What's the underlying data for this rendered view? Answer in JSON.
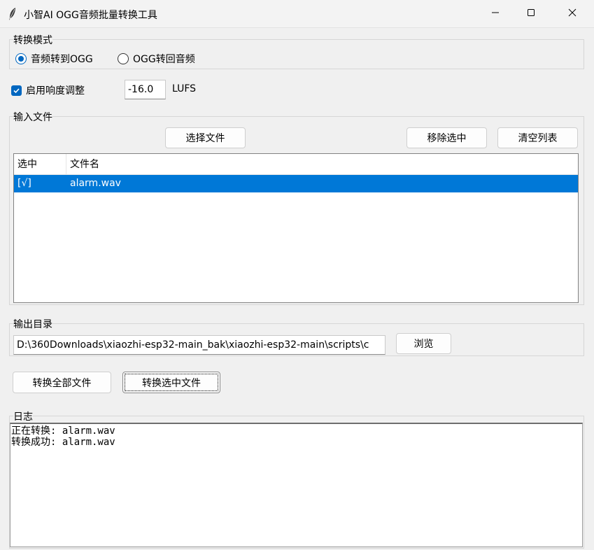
{
  "window": {
    "title": "小智AI OGG音频批量转换工具"
  },
  "mode": {
    "group_label": "转换模式",
    "options": [
      {
        "label": "音频转到OGG",
        "selected": true
      },
      {
        "label": "OGG转回音频",
        "selected": false
      }
    ]
  },
  "loudness": {
    "checkbox_label": "启用响度调整",
    "checked": true,
    "value": "-16.0",
    "unit": "LUFS"
  },
  "input": {
    "group_label": "输入文件",
    "select_button": "选择文件",
    "remove_button": "移除选中",
    "clear_button": "清空列表",
    "columns": [
      "选中",
      "文件名"
    ],
    "rows": [
      {
        "selected_mark": "[√]",
        "filename": "alarm.wav",
        "highlighted": true
      }
    ]
  },
  "output": {
    "group_label": "输出目录",
    "path": "D:\\360Downloads\\xiaozhi-esp32-main_bak\\xiaozhi-esp32-main\\scripts\\c",
    "browse_button": "浏览"
  },
  "actions": {
    "convert_all": "转换全部文件",
    "convert_selected": "转换选中文件"
  },
  "log": {
    "group_label": "日志",
    "lines": [
      "正在转换: alarm.wav",
      "转换成功: alarm.wav"
    ]
  },
  "colors": {
    "accent": "#0067c0",
    "selection": "#0078d7",
    "background": "#f0f0f0"
  },
  "icons": {
    "app": "feather-icon",
    "minimize": "minimize-icon",
    "maximize": "maximize-icon",
    "close": "close-icon",
    "check": "checkmark-icon"
  }
}
